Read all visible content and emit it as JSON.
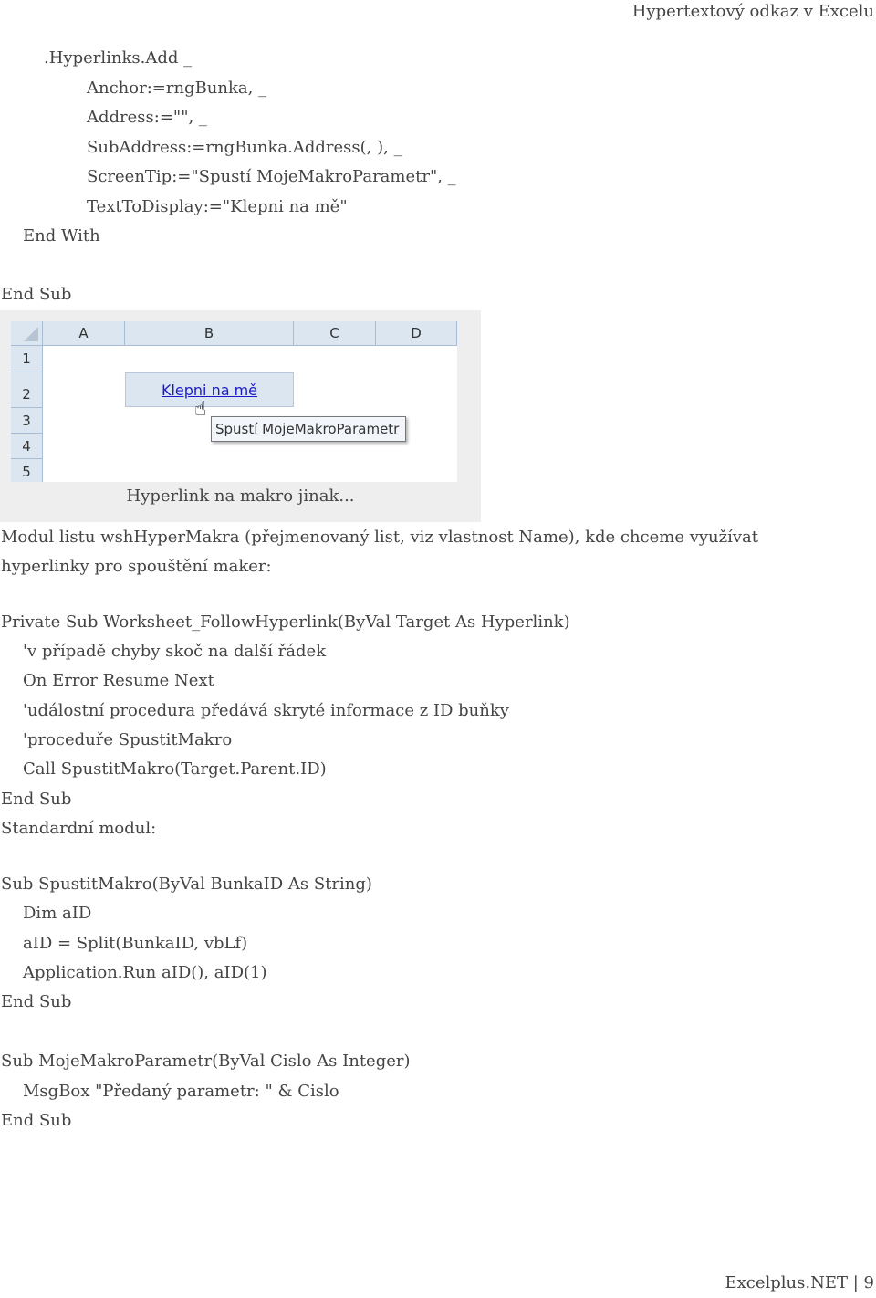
{
  "header": {
    "title": "Hypertextový odkaz v Excelu"
  },
  "code_block_1": [
    ".Hyperlinks.Add _",
    "Anchor:=rngBunka, _",
    "Address:=\"\", _",
    "SubAddress:=rngBunka.Address(, ), _",
    "ScreenTip:=\"Spustí MojeMakroParametr\", _",
    "TextToDisplay:=\"Klepni na mě\"",
    "End With",
    "End Sub"
  ],
  "figure": {
    "columns": [
      "A",
      "B",
      "C",
      "D"
    ],
    "rows": [
      "1",
      "2",
      "3",
      "4",
      "5"
    ],
    "cell_link": "Klepni na mě",
    "tooltip": "Spustí MojeMakroParametr",
    "caption": "Hyperlink na makro jinak..."
  },
  "paragraph_1": [
    "Modul listu wshHyperMakra (přejmenovaný list, viz vlastnost Name), kde chceme využívat",
    "hyperlinky pro spouštění maker:"
  ],
  "code_block_2": [
    "Private Sub Worksheet_FollowHyperlink(ByVal Target As Hyperlink)",
    "'v případě chyby skoč na další řádek",
    "On Error Resume Next",
    "'událostní procedura předává skryté informace z ID buňky",
    "'proceduře SpustitMakro",
    "Call SpustitMakro(Target.Parent.ID)",
    "End Sub"
  ],
  "paragraph_2": "Standardní modul:",
  "code_block_3": [
    "Sub SpustitMakro(ByVal BunkaID As String)",
    "Dim aID",
    "aID = Split(BunkaID, vbLf)",
    "Application.Run aID(), aID(1)",
    "End Sub"
  ],
  "code_block_4": [
    "Sub MojeMakroParametr(ByVal Cislo As Integer)",
    "MsgBox \"Předaný parametr: \" & Cislo",
    "End Sub"
  ],
  "footer": {
    "site": "Excelplus.NET",
    "separator": "|",
    "page": "9"
  }
}
